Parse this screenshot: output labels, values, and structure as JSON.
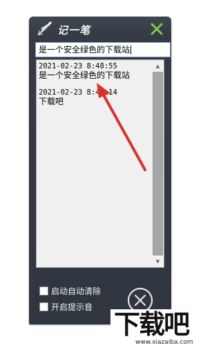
{
  "app": {
    "title": "记一笔",
    "close_icon": "close-x-icon",
    "logo_icon": "quill-pen-icon",
    "accent_color": "#8bc34a"
  },
  "input": {
    "value": "是一个安全绿色的下载站"
  },
  "notes": [
    {
      "time": "2021-02-23 8:48:55",
      "text": "是一个安全绿色的下载站"
    },
    {
      "time": "2021-02-23 8:48:14",
      "text": "下载吧"
    }
  ],
  "options": {
    "auto_clear_label": "启动自动清除",
    "sound_label": "开启提示音"
  },
  "exit_icon": "circle-x-icon",
  "watermark": {
    "logo_text": "下载吧",
    "url": "www.xiazaiba.com"
  }
}
